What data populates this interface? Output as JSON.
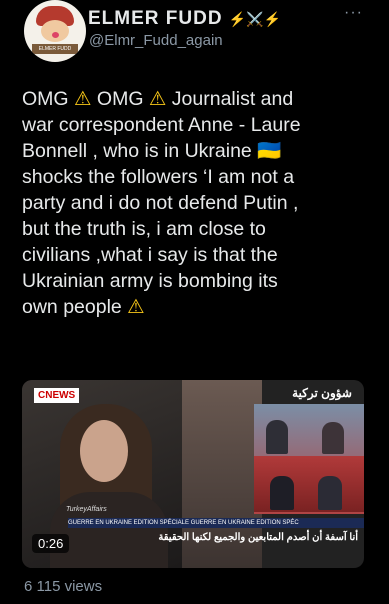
{
  "tweet": {
    "display_name": "ELMER FUDD",
    "badges": "⚡️⚔️⚡️",
    "handle": "@Elmr_Fudd_again",
    "more_icon": "more-options-icon",
    "lines": [
      "OMG ⚠ OMG ⚠ Journalist and",
      "war correspondent  Anne - Laure",
      "Bonnell ,  who is in Ukraine 🇺🇦",
      "shocks the followers ‘I am not a",
      "party and i do not defend Putin ,",
      "but the truth is, i am close to",
      "civilians ,what i say is that the",
      "Ukrainian army is bombing its",
      "own people ⚠"
    ],
    "views": "6 115 views"
  },
  "video": {
    "duration": "0:26",
    "channel_logo": "CNEWS",
    "arabic_logo": "شؤون تركية",
    "watermark": "TurkeyAffairs",
    "ticker": "GUERRE EN UKRAINE   EDITION SPÉCIALE   GUERRE EN UKRAINE   EDITION SPÉC",
    "caption": "أنا آسفة أن أصدم المتابعين والجميع لكنها الحقيقة"
  }
}
